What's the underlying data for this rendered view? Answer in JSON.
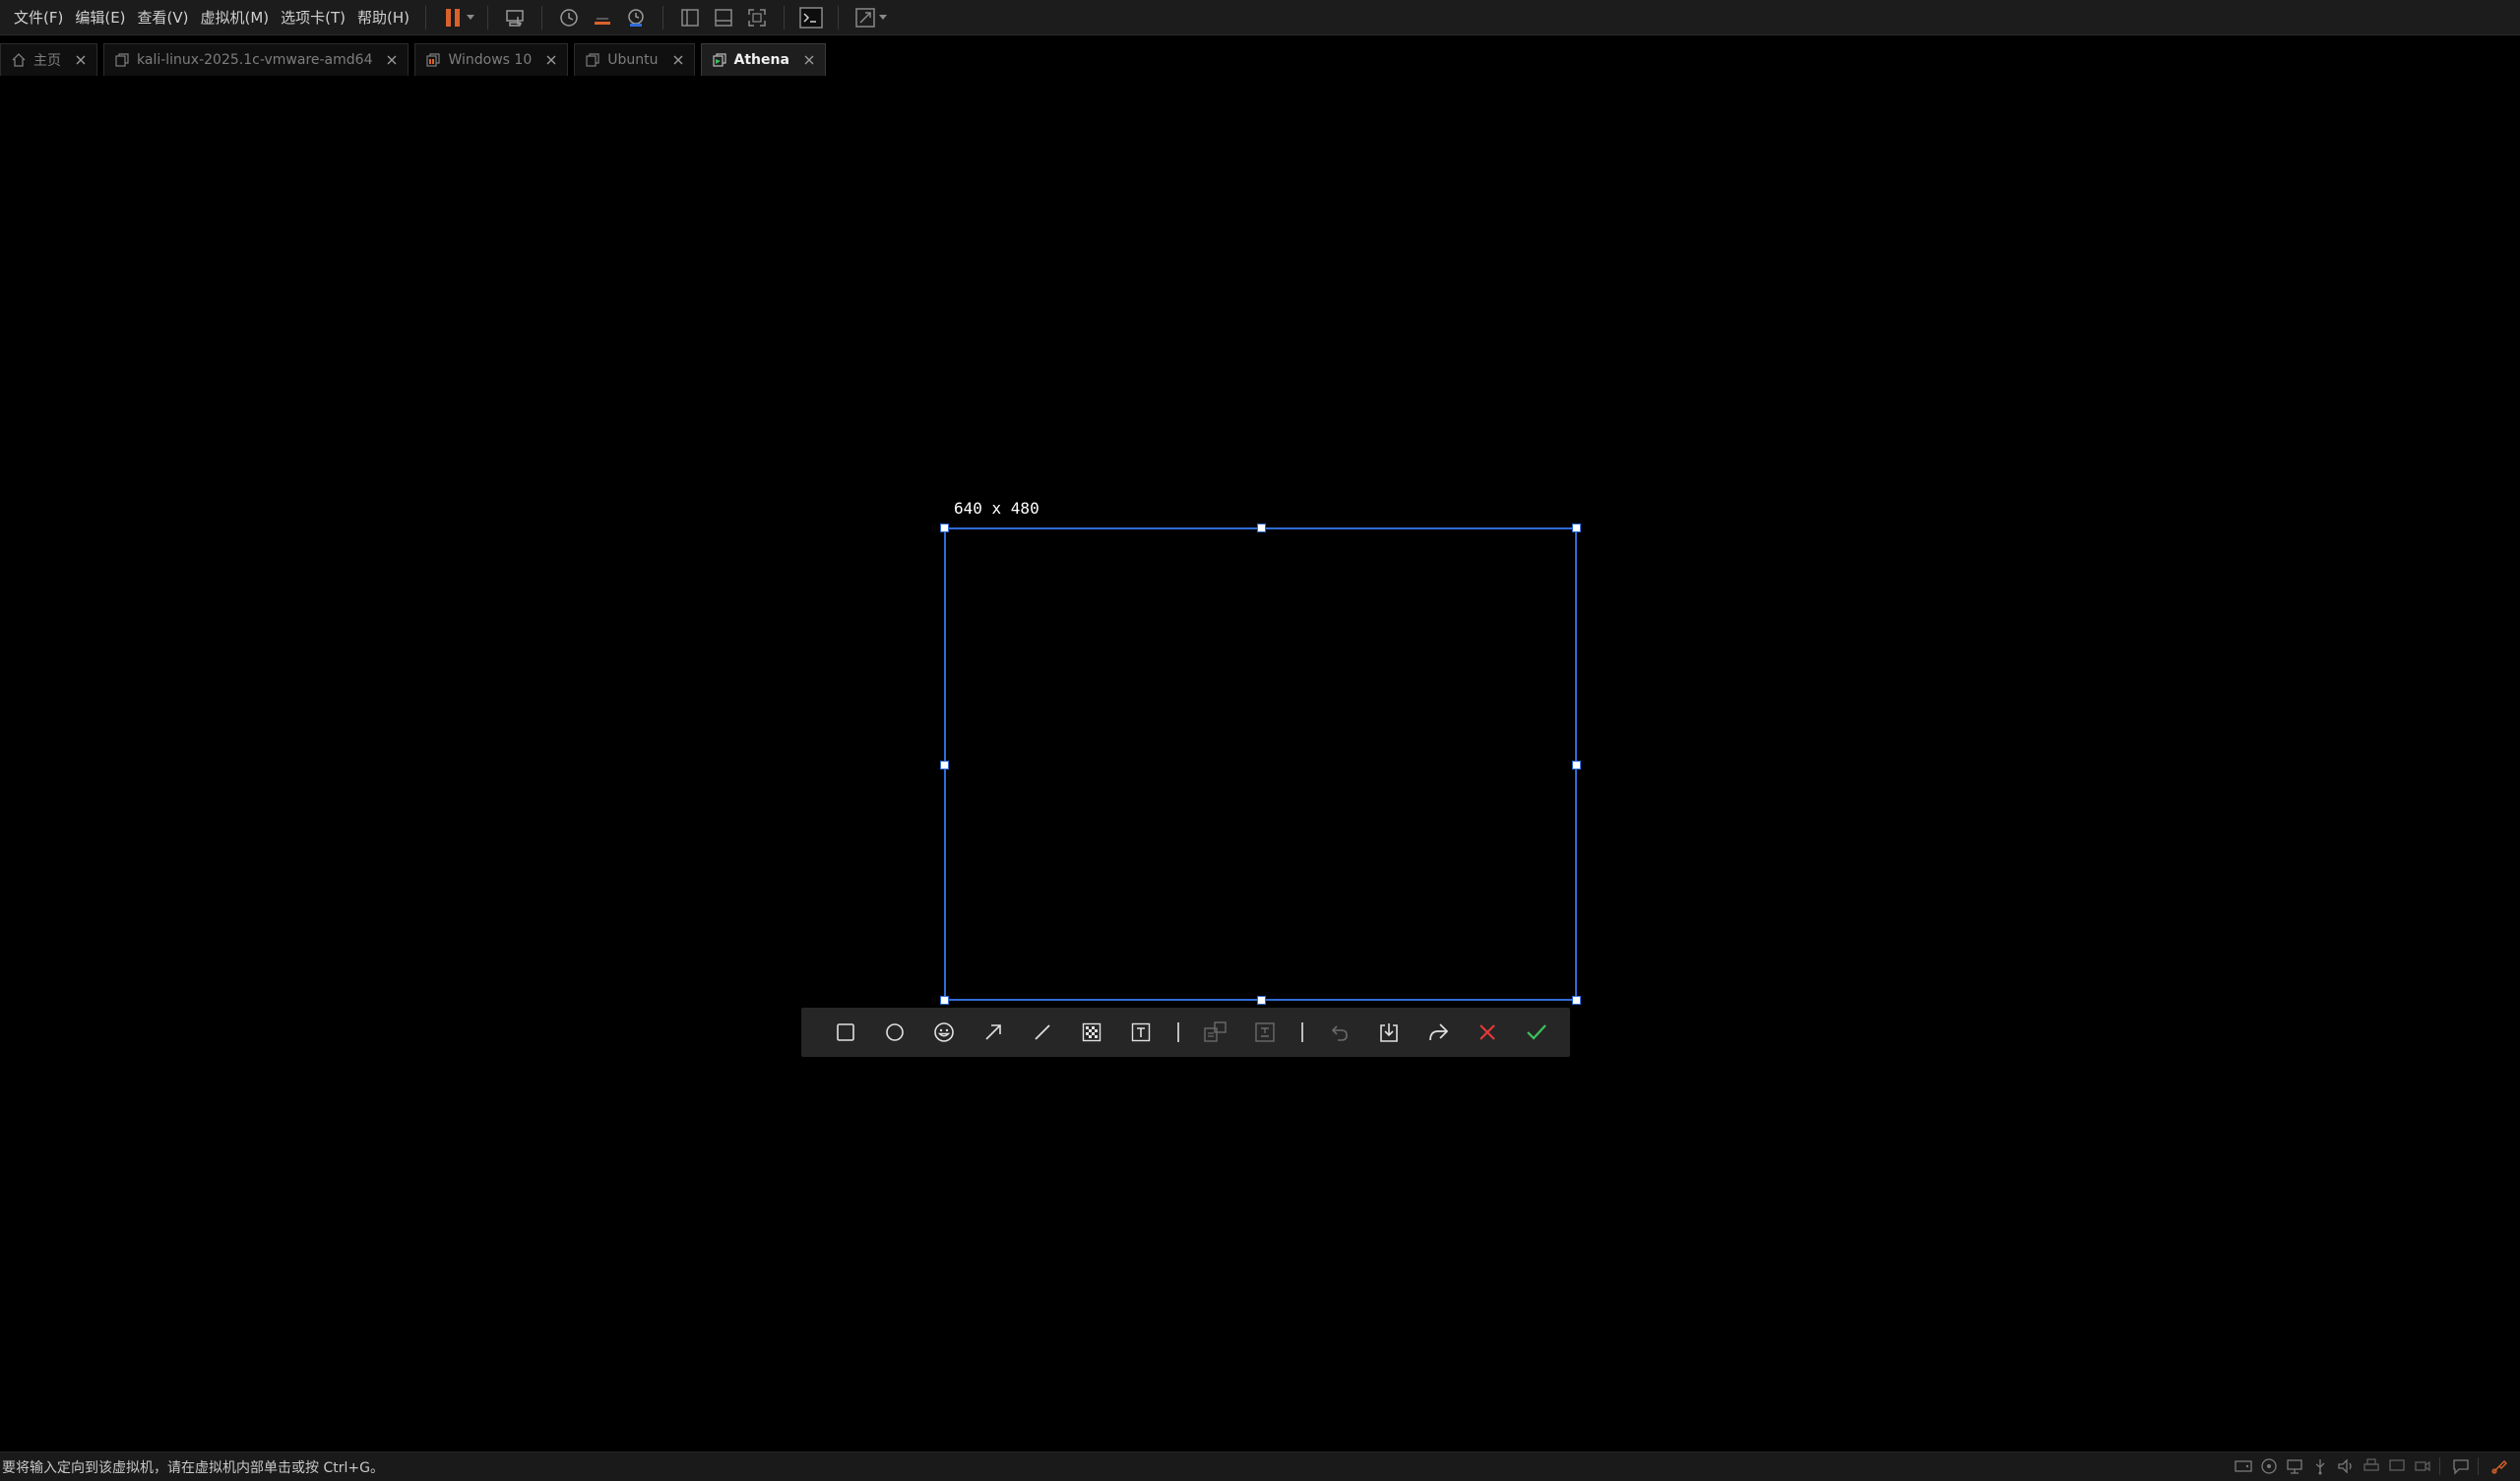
{
  "menubar": {
    "items": [
      "文件(F)",
      "编辑(E)",
      "查看(V)",
      "虚拟机(M)",
      "选项卡(T)",
      "帮助(H)"
    ]
  },
  "toolbar": {
    "icons": [
      "pause-icon",
      "send-ctrl-alt-del-icon",
      "snapshot-icon",
      "revert-snapshot-icon",
      "snapshot-manager-icon",
      "show-library-icon",
      "thumbnail-bar-icon",
      "fullscreen-icon",
      "console-icon",
      "unity-stretch-icon"
    ],
    "accent_pause": "#d9622b"
  },
  "tabs": [
    {
      "label": "主页",
      "icon": "home-icon",
      "active": false
    },
    {
      "label": "kali-linux-2025.1c-vmware-amd64",
      "icon": "vm-icon",
      "active": false
    },
    {
      "label": "Windows 10",
      "icon": "vm-paused-icon",
      "active": false
    },
    {
      "label": "Ubuntu",
      "icon": "vm-icon",
      "active": false
    },
    {
      "label": "Athena",
      "icon": "vm-running-icon",
      "active": true
    }
  ],
  "capture": {
    "size_label": "640 x 480",
    "selection_color": "#2f6bd6"
  },
  "capture_toolbar": {
    "tools": [
      "rectangle-tool",
      "ellipse-tool",
      "emoji-tool",
      "arrow-tool",
      "line-tool",
      "mosaic-tool",
      "text-tool",
      "pin-tool",
      "ocr-tool",
      "undo-tool",
      "save-tool",
      "share-tool",
      "cancel-tool",
      "confirm-tool"
    ],
    "cancel_color": "#e5383b",
    "confirm_color": "#3cc35a"
  },
  "statusbar": {
    "message": "要将输入定向到该虚拟机，请在虚拟机内部单击或按 Ctrl+G。"
  }
}
